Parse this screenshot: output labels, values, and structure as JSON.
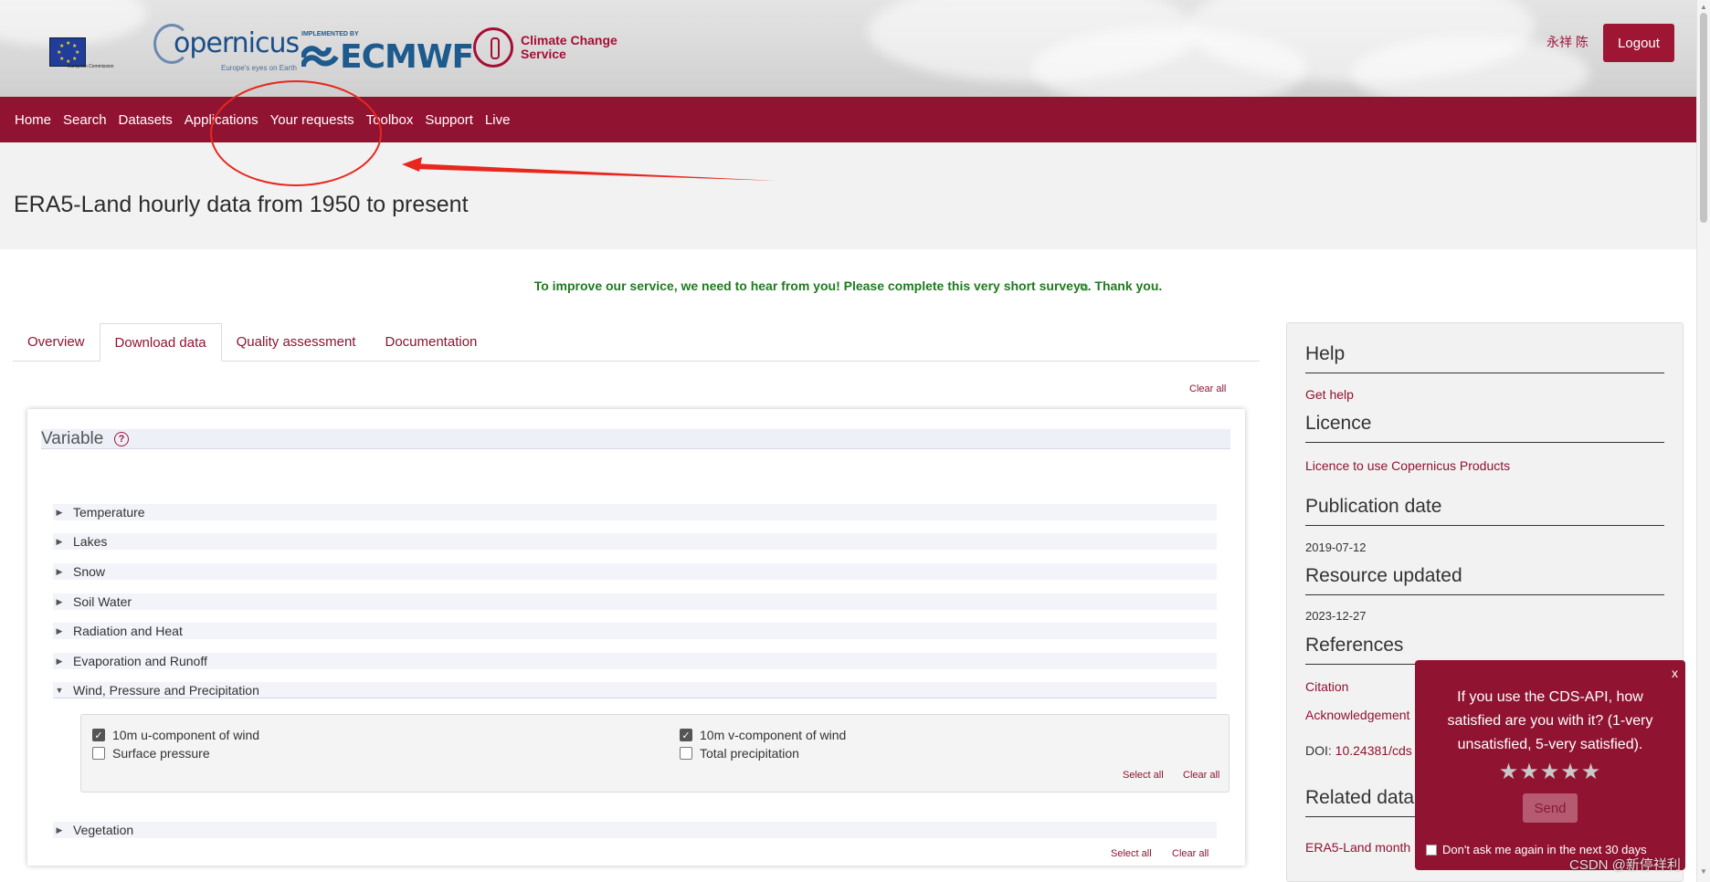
{
  "header": {
    "eu_logo_text": "European Commission",
    "copernicus_word": "opernicus",
    "copernicus_tagline": "Europe's eyes on Earth",
    "ecmwf_implemented_by": "IMPLEMENTED BY",
    "ecmwf_word": "ECMWF",
    "c3s_line1": "Climate Change",
    "c3s_line2": "Service",
    "user_name": "永祥 陈",
    "logout_label": "Logout"
  },
  "nav": {
    "items": [
      "Home",
      "Search",
      "Datasets",
      "Applications",
      "Your requests",
      "Toolbox",
      "Support",
      "Live"
    ]
  },
  "page": {
    "title": "ERA5-Land hourly data from 1950 to present",
    "survey_prefix": "To improve our service, we need to hear from you! Please complete ",
    "survey_link": "this very short survey",
    "survey_suffix": ". Thank you."
  },
  "tabs": [
    "Overview",
    "Download data",
    "Quality assessment",
    "Documentation"
  ],
  "active_tab": "Download data",
  "form": {
    "clear_all_top": "Clear all",
    "variable_title": "Variable",
    "help_icon_glyph": "?",
    "groups": [
      {
        "label": "Temperature",
        "expanded": false
      },
      {
        "label": "Lakes",
        "expanded": false
      },
      {
        "label": "Snow",
        "expanded": false
      },
      {
        "label": "Soil Water",
        "expanded": false
      },
      {
        "label": "Radiation and Heat",
        "expanded": false
      },
      {
        "label": "Evaporation and Runoff",
        "expanded": false
      },
      {
        "label": "Wind, Pressure and Precipitation",
        "expanded": true
      },
      {
        "label": "Vegetation",
        "expanded": false
      }
    ],
    "wind_options": [
      {
        "label": "10m u-component of wind",
        "checked": true
      },
      {
        "label": "10m v-component of wind",
        "checked": true
      },
      {
        "label": "Surface pressure",
        "checked": false
      },
      {
        "label": "Total precipitation",
        "checked": false
      }
    ],
    "select_all": "Select all",
    "clear_all": "Clear all"
  },
  "sidebar": {
    "help_heading": "Help",
    "get_help": "Get help",
    "licence_heading": "Licence",
    "licence_link": "Licence to use Copernicus Products",
    "publication_heading": "Publication date",
    "publication_date": "2019-07-12",
    "updated_heading": "Resource updated",
    "updated_date": "2023-12-27",
    "references_heading": "References",
    "citation": "Citation",
    "acknowledgement": "Acknowledgement",
    "doi_label": "DOI: ",
    "doi_value": "10.24381/cds",
    "related_heading": "Related data",
    "related_link": "ERA5-Land month"
  },
  "popup": {
    "close": "x",
    "question": "If you use the CDS-API, how satisfied are you with it? (1-very unsatisfied, 5-very satisfied).",
    "stars": "★★★★★",
    "rating_max": 5,
    "send_label": "Send",
    "dont_ask": "Don't ask me again in the next 30 days"
  },
  "watermark": "CSDN @新停祥利",
  "colors": {
    "brand": "#901432",
    "link": "#8f1331",
    "survey": "#1f7a1f",
    "annotation": "#e8271d"
  },
  "icons": {
    "collapsed_arrow": "▶",
    "expanded_arrow": "▼",
    "check": "✓",
    "external_link": "⧉",
    "scroll_up": "▲",
    "scroll_down": "▼"
  }
}
